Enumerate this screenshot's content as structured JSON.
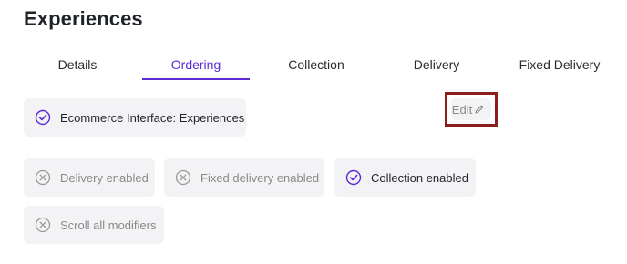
{
  "page": {
    "title": "Experiences"
  },
  "tabs": [
    {
      "label": "Details",
      "active": false
    },
    {
      "label": "Ordering",
      "active": true
    },
    {
      "label": "Collection",
      "active": false
    },
    {
      "label": "Delivery",
      "active": false
    },
    {
      "label": "Fixed Delivery",
      "active": false
    }
  ],
  "ordering": {
    "interface_chip": {
      "label": "Ecommerce Interface: Experiences",
      "icon": "check-circle-icon",
      "state": "checked"
    },
    "edit_button": {
      "label": "Edit",
      "icon": "pencil-icon"
    },
    "options": [
      {
        "label": "Delivery enabled",
        "icon": "x-circle-icon",
        "state": "disabled"
      },
      {
        "label": "Fixed delivery enabled",
        "icon": "x-circle-icon",
        "state": "disabled"
      },
      {
        "label": "Collection enabled",
        "icon": "check-circle-icon",
        "state": "checked"
      },
      {
        "label": "Scroll all modifiers",
        "icon": "x-circle-icon",
        "state": "disabled"
      }
    ]
  },
  "colors": {
    "accent": "#5b2bd6",
    "disabled_text": "#8a8a8a",
    "chip_bg": "#f3f3f5",
    "highlight_border": "#8b1d1d"
  }
}
